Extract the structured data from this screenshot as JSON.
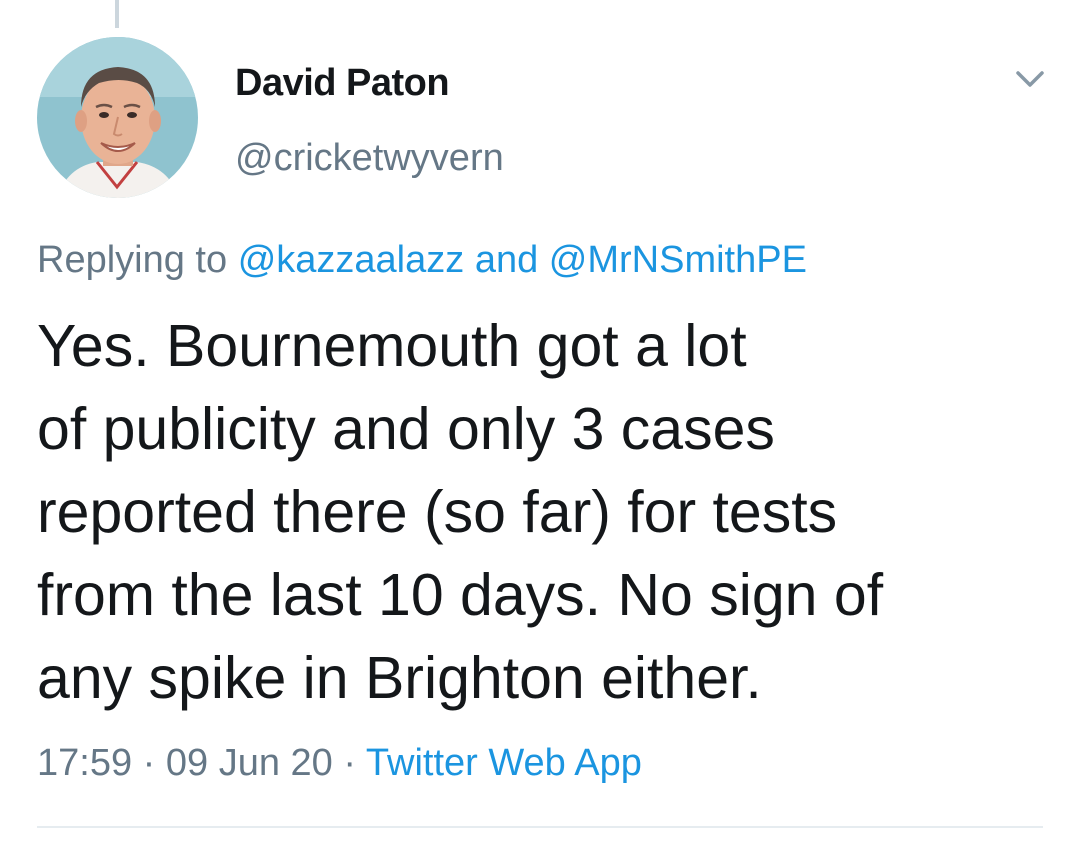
{
  "author": {
    "display_name": "David Paton",
    "handle": "@cricketwyvern",
    "avatar_icon": "user-avatar-photo"
  },
  "reply": {
    "prefix": "Replying to",
    "mentions": [
      "@kazzaalazz",
      "@MrNSmithPE"
    ],
    "joiner": "and"
  },
  "tweet": {
    "lines": [
      "Yes. Bournemouth got a lot",
      "of publicity and only 3 cases",
      "reported there (so far) for tests",
      "from the last 10 days. No sign of",
      "any spike in Brighton either."
    ]
  },
  "meta": {
    "time": "17:59",
    "separator": "·",
    "date": "09 Jun 20",
    "source": "Twitter Web App"
  },
  "icons": {
    "menu_caret": "chevron-down-icon"
  },
  "colors": {
    "link": "#1b95e0",
    "secondary_text": "#657786",
    "primary_text": "#14171a",
    "divider": "#e6ecf0"
  }
}
